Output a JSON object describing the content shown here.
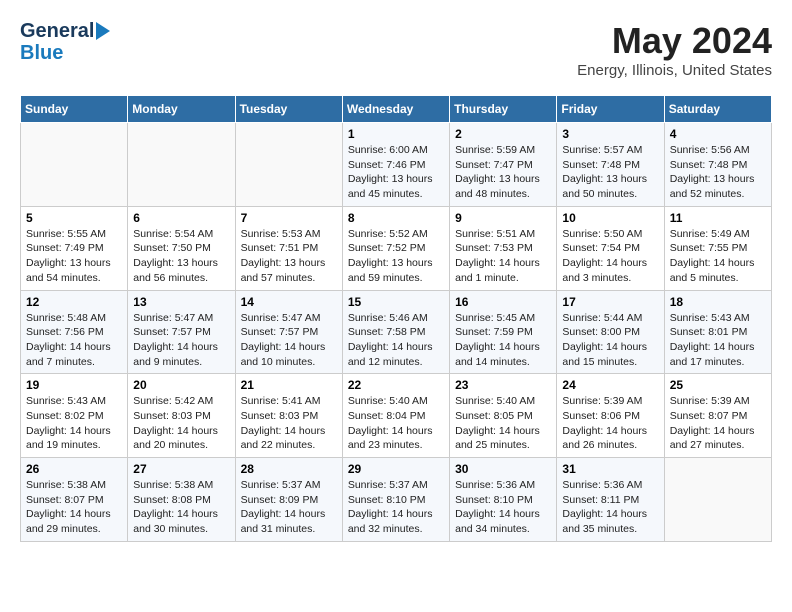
{
  "logo": {
    "line1": "General",
    "line2": "Blue"
  },
  "title": "May 2024",
  "subtitle": "Energy, Illinois, United States",
  "days_of_week": [
    "Sunday",
    "Monday",
    "Tuesday",
    "Wednesday",
    "Thursday",
    "Friday",
    "Saturday"
  ],
  "weeks": [
    [
      {
        "day": "",
        "info": ""
      },
      {
        "day": "",
        "info": ""
      },
      {
        "day": "",
        "info": ""
      },
      {
        "day": "1",
        "info": "Sunrise: 6:00 AM\nSunset: 7:46 PM\nDaylight: 13 hours\nand 45 minutes."
      },
      {
        "day": "2",
        "info": "Sunrise: 5:59 AM\nSunset: 7:47 PM\nDaylight: 13 hours\nand 48 minutes."
      },
      {
        "day": "3",
        "info": "Sunrise: 5:57 AM\nSunset: 7:48 PM\nDaylight: 13 hours\nand 50 minutes."
      },
      {
        "day": "4",
        "info": "Sunrise: 5:56 AM\nSunset: 7:48 PM\nDaylight: 13 hours\nand 52 minutes."
      }
    ],
    [
      {
        "day": "5",
        "info": "Sunrise: 5:55 AM\nSunset: 7:49 PM\nDaylight: 13 hours\nand 54 minutes."
      },
      {
        "day": "6",
        "info": "Sunrise: 5:54 AM\nSunset: 7:50 PM\nDaylight: 13 hours\nand 56 minutes."
      },
      {
        "day": "7",
        "info": "Sunrise: 5:53 AM\nSunset: 7:51 PM\nDaylight: 13 hours\nand 57 minutes."
      },
      {
        "day": "8",
        "info": "Sunrise: 5:52 AM\nSunset: 7:52 PM\nDaylight: 13 hours\nand 59 minutes."
      },
      {
        "day": "9",
        "info": "Sunrise: 5:51 AM\nSunset: 7:53 PM\nDaylight: 14 hours\nand 1 minute."
      },
      {
        "day": "10",
        "info": "Sunrise: 5:50 AM\nSunset: 7:54 PM\nDaylight: 14 hours\nand 3 minutes."
      },
      {
        "day": "11",
        "info": "Sunrise: 5:49 AM\nSunset: 7:55 PM\nDaylight: 14 hours\nand 5 minutes."
      }
    ],
    [
      {
        "day": "12",
        "info": "Sunrise: 5:48 AM\nSunset: 7:56 PM\nDaylight: 14 hours\nand 7 minutes."
      },
      {
        "day": "13",
        "info": "Sunrise: 5:47 AM\nSunset: 7:57 PM\nDaylight: 14 hours\nand 9 minutes."
      },
      {
        "day": "14",
        "info": "Sunrise: 5:47 AM\nSunset: 7:57 PM\nDaylight: 14 hours\nand 10 minutes."
      },
      {
        "day": "15",
        "info": "Sunrise: 5:46 AM\nSunset: 7:58 PM\nDaylight: 14 hours\nand 12 minutes."
      },
      {
        "day": "16",
        "info": "Sunrise: 5:45 AM\nSunset: 7:59 PM\nDaylight: 14 hours\nand 14 minutes."
      },
      {
        "day": "17",
        "info": "Sunrise: 5:44 AM\nSunset: 8:00 PM\nDaylight: 14 hours\nand 15 minutes."
      },
      {
        "day": "18",
        "info": "Sunrise: 5:43 AM\nSunset: 8:01 PM\nDaylight: 14 hours\nand 17 minutes."
      }
    ],
    [
      {
        "day": "19",
        "info": "Sunrise: 5:43 AM\nSunset: 8:02 PM\nDaylight: 14 hours\nand 19 minutes."
      },
      {
        "day": "20",
        "info": "Sunrise: 5:42 AM\nSunset: 8:03 PM\nDaylight: 14 hours\nand 20 minutes."
      },
      {
        "day": "21",
        "info": "Sunrise: 5:41 AM\nSunset: 8:03 PM\nDaylight: 14 hours\nand 22 minutes."
      },
      {
        "day": "22",
        "info": "Sunrise: 5:40 AM\nSunset: 8:04 PM\nDaylight: 14 hours\nand 23 minutes."
      },
      {
        "day": "23",
        "info": "Sunrise: 5:40 AM\nSunset: 8:05 PM\nDaylight: 14 hours\nand 25 minutes."
      },
      {
        "day": "24",
        "info": "Sunrise: 5:39 AM\nSunset: 8:06 PM\nDaylight: 14 hours\nand 26 minutes."
      },
      {
        "day": "25",
        "info": "Sunrise: 5:39 AM\nSunset: 8:07 PM\nDaylight: 14 hours\nand 27 minutes."
      }
    ],
    [
      {
        "day": "26",
        "info": "Sunrise: 5:38 AM\nSunset: 8:07 PM\nDaylight: 14 hours\nand 29 minutes."
      },
      {
        "day": "27",
        "info": "Sunrise: 5:38 AM\nSunset: 8:08 PM\nDaylight: 14 hours\nand 30 minutes."
      },
      {
        "day": "28",
        "info": "Sunrise: 5:37 AM\nSunset: 8:09 PM\nDaylight: 14 hours\nand 31 minutes."
      },
      {
        "day": "29",
        "info": "Sunrise: 5:37 AM\nSunset: 8:10 PM\nDaylight: 14 hours\nand 32 minutes."
      },
      {
        "day": "30",
        "info": "Sunrise: 5:36 AM\nSunset: 8:10 PM\nDaylight: 14 hours\nand 34 minutes."
      },
      {
        "day": "31",
        "info": "Sunrise: 5:36 AM\nSunset: 8:11 PM\nDaylight: 14 hours\nand 35 minutes."
      },
      {
        "day": "",
        "info": ""
      }
    ]
  ]
}
